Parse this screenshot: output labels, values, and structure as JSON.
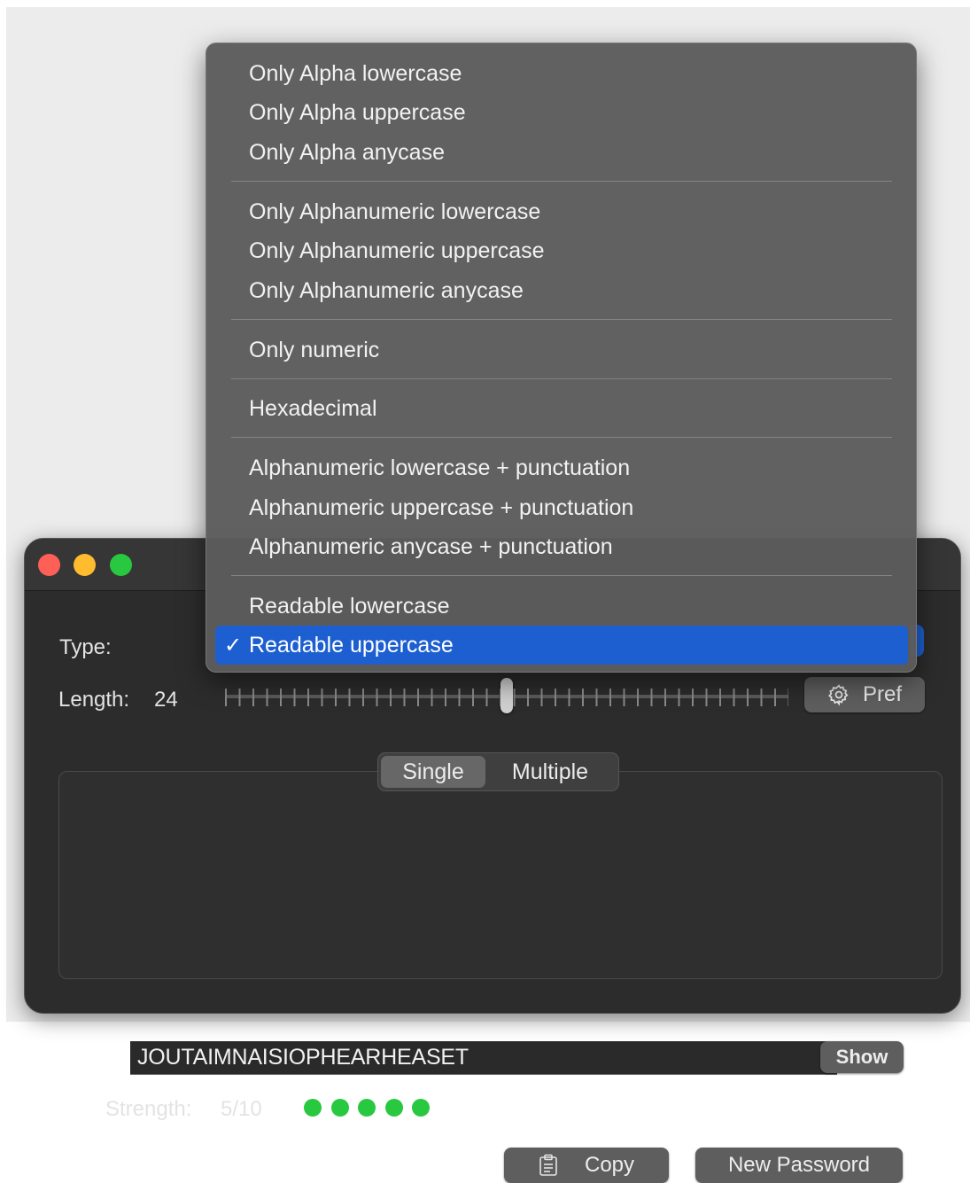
{
  "window": {
    "type_label": "Type:",
    "length_label": "Length:",
    "length_value": "24",
    "length_slider": {
      "value": 24,
      "min": 0,
      "max": 48
    },
    "pref_button": "Pref",
    "mode_tabs": [
      "Single",
      "Multiple"
    ],
    "selected_mode": "Single",
    "password_value": "JOUTAIMNAISIOPHEARHEASET",
    "show_button": "Show",
    "strength_label": "Strength:",
    "strength_value": "5/10",
    "strength_dots": 5,
    "strength_color": "#28c840",
    "copy_button": "Copy",
    "new_password_button": "New Password"
  },
  "type_menu": {
    "groups": [
      [
        "Only Alpha lowercase",
        "Only Alpha uppercase",
        "Only Alpha anycase"
      ],
      [
        "Only Alphanumeric lowercase",
        "Only Alphanumeric uppercase",
        "Only Alphanumeric anycase"
      ],
      [
        "Only numeric"
      ],
      [
        "Hexadecimal"
      ],
      [
        "Alphanumeric lowercase + punctuation",
        "Alphanumeric uppercase + punctuation",
        "Alphanumeric anycase + punctuation"
      ],
      [
        "Readable lowercase",
        "Readable uppercase"
      ]
    ],
    "selected": "Readable uppercase",
    "checkmark": "✓",
    "highlight_color": "#1d5fd0"
  },
  "icons": {
    "traffic_lights": [
      "close-icon",
      "minimize-icon",
      "zoom-icon"
    ],
    "pref": "gear-icon",
    "copy": "clipboard-icon",
    "check": "checkmark-icon"
  }
}
